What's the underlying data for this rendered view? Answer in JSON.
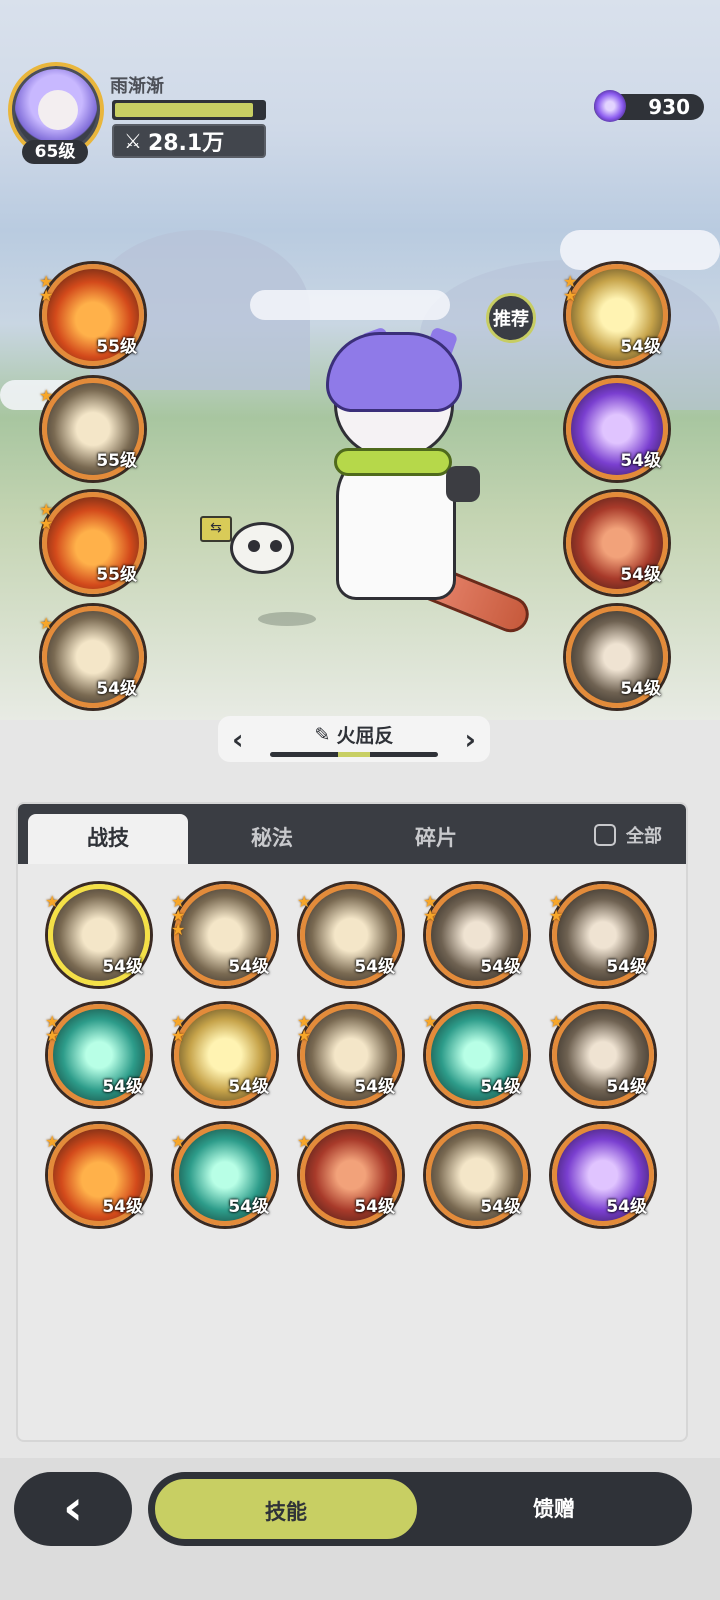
{
  "player": {
    "name": "雨渐渐",
    "level": "65级",
    "power": "28.1万",
    "exp_fraction": 0.93
  },
  "currency": {
    "amount": "930",
    "icon": "purple-gem-icon"
  },
  "equipped_left": [
    {
      "level": "55级",
      "stars": 2,
      "style": "fire"
    },
    {
      "level": "55级",
      "stars": 1,
      "style": "light"
    },
    {
      "level": "55级",
      "stars": 2,
      "style": "fire"
    },
    {
      "level": "54级",
      "stars": 1,
      "style": "light"
    }
  ],
  "equipped_right": [
    {
      "level": "54级",
      "stars": 2,
      "style": "gold"
    },
    {
      "level": "54级",
      "stars": 0,
      "style": "purple"
    },
    {
      "level": "54级",
      "stars": 0,
      "style": "red"
    },
    {
      "level": "54级",
      "stars": 0,
      "style": "dark"
    }
  ],
  "recommend_label": "推荐",
  "preset": {
    "name": "火屈反",
    "edit_icon": "pencil-icon"
  },
  "tabs": {
    "combat": "战技",
    "secret": "秘法",
    "fragment": "碎片",
    "all_label": "全部"
  },
  "skills": [
    {
      "level": "54级",
      "stars": 1,
      "style": "light",
      "selected": true
    },
    {
      "level": "54级",
      "stars": 3,
      "style": "light"
    },
    {
      "level": "54级",
      "stars": 1,
      "style": "light"
    },
    {
      "level": "54级",
      "stars": 2,
      "style": "dark"
    },
    {
      "level": "54级",
      "stars": 2,
      "style": "dark"
    },
    {
      "level": "54级",
      "stars": 2,
      "style": "teal"
    },
    {
      "level": "54级",
      "stars": 2,
      "style": "gold"
    },
    {
      "level": "54级",
      "stars": 2,
      "style": "light"
    },
    {
      "level": "54级",
      "stars": 1,
      "style": "teal"
    },
    {
      "level": "54级",
      "stars": 1,
      "style": "dark"
    },
    {
      "level": "54级",
      "stars": 1,
      "style": "fire"
    },
    {
      "level": "54级",
      "stars": 1,
      "style": "teal"
    },
    {
      "level": "54级",
      "stars": 1,
      "style": "red"
    },
    {
      "level": "54级",
      "stars": 0,
      "style": "light"
    },
    {
      "level": "54级",
      "stars": 0,
      "style": "purple"
    }
  ],
  "bottom_nav": {
    "skills": "技能",
    "gift": "馈赠"
  }
}
